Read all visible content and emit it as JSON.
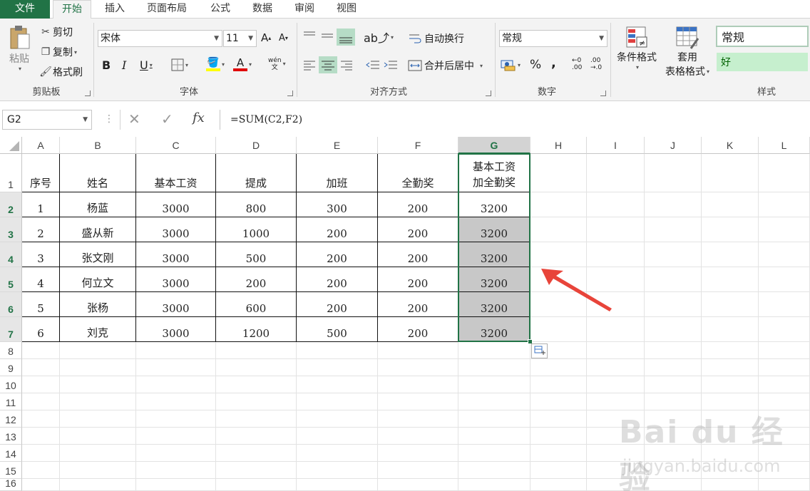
{
  "ribbon_tabs": [
    "文件",
    "开始",
    "插入",
    "页面布局",
    "公式",
    "数据",
    "审阅",
    "视图"
  ],
  "clipboard": {
    "paste": "粘贴",
    "cut": "剪切",
    "copy": "复制",
    "format_painter": "格式刷",
    "label": "剪贴板"
  },
  "font": {
    "name": "宋体",
    "size": "11",
    "label": "字体",
    "bold": "B",
    "italic": "I",
    "underline": "U",
    "grow": "A",
    "shrink": "A",
    "font_color_glyph": "A",
    "phonetic_glyph": "wén\n文"
  },
  "alignment": {
    "wrap_text": "自动换行",
    "merge_center": "合并后居中",
    "label": "对齐方式"
  },
  "number": {
    "format": "常规",
    "label": "数字",
    "percent": "%",
    "comma": ",",
    "inc_decimal": "←0\n.00",
    "dec_decimal": ".00\n→.0"
  },
  "styles": {
    "conditional_line1": "条件格式",
    "table_line1": "套用",
    "table_line2": "表格格式",
    "normal": "常规",
    "good": "好",
    "label": "样式"
  },
  "formula_bar": {
    "name_box": "G2",
    "formula": "=SUM(C2,F2)",
    "fx": "fx"
  },
  "columns": [
    "A",
    "B",
    "C",
    "D",
    "E",
    "F",
    "G",
    "H",
    "I",
    "J",
    "K",
    "L"
  ],
  "rows": [
    "1",
    "2",
    "3",
    "4",
    "5",
    "6",
    "7",
    "8",
    "9",
    "10",
    "11",
    "12",
    "13",
    "14",
    "15",
    "16"
  ],
  "sheet": {
    "headers": [
      "序号",
      "姓名",
      "基本工资",
      "提成",
      "加班",
      "全勤奖"
    ],
    "g_header_line1": "基本工资",
    "g_header_line2": "加全勤奖",
    "data": [
      [
        "1",
        "杨蓝",
        "3000",
        "800",
        "300",
        "200",
        "3200"
      ],
      [
        "2",
        "盛从新",
        "3000",
        "1000",
        "200",
        "200",
        "3200"
      ],
      [
        "3",
        "张文刚",
        "3000",
        "500",
        "200",
        "200",
        "3200"
      ],
      [
        "4",
        "何立文",
        "3000",
        "200",
        "200",
        "200",
        "3200"
      ],
      [
        "5",
        "张杨",
        "3000",
        "600",
        "200",
        "200",
        "3200"
      ],
      [
        "6",
        "刘克",
        "3000",
        "1200",
        "500",
        "200",
        "3200"
      ]
    ]
  },
  "watermark": {
    "brand": "Bai du 经验",
    "url": "jingyan.baidu.com"
  },
  "colors": {
    "accent": "#217346",
    "arrow": "#e8443a",
    "fill_selection": "#c8c8c8",
    "good_style": "#c6efce"
  }
}
